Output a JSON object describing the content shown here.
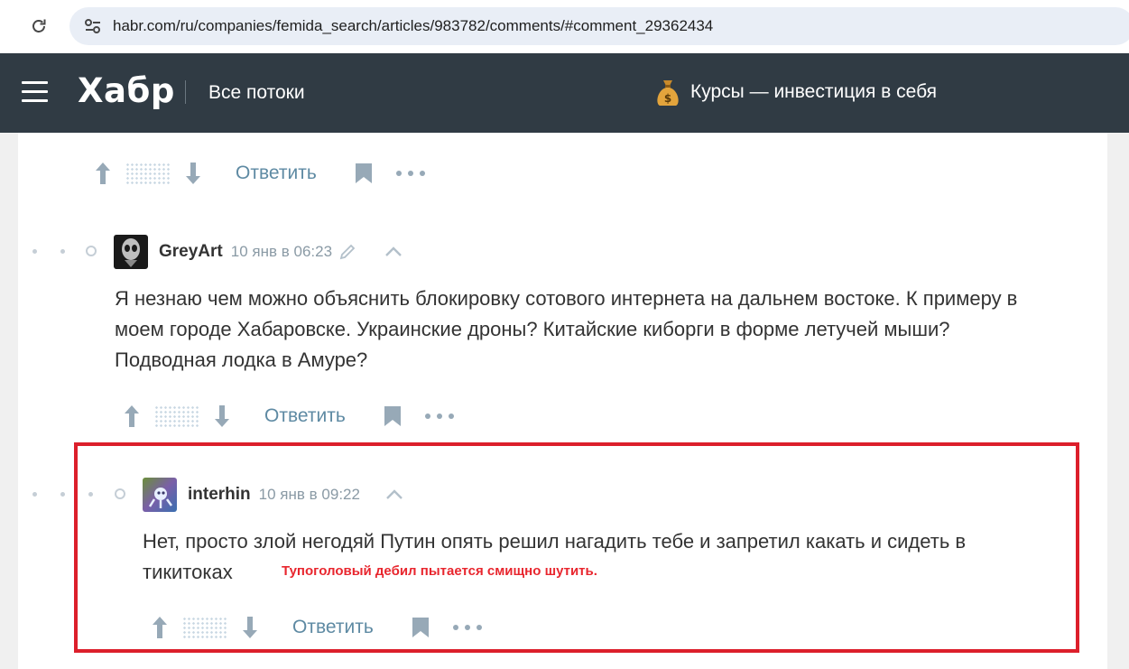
{
  "browser": {
    "url": "habr.com/ru/companies/femida_search/articles/983782/comments/#comment_29362434"
  },
  "header": {
    "logo": "Хабр",
    "nav_label": "Все потоки",
    "promo_icon": "money-bag-icon",
    "promo_label": "Курсы — инвестиция в себя"
  },
  "actions": {
    "reply_label": "Ответить"
  },
  "comments": [
    {
      "author": "GreyArt",
      "time": "10 янв в 06:23",
      "edited": true,
      "lines": [
        "Я незнаю чем можно объяснить блокировку сотового интернета на дальнем востоке. К примеру в",
        "моем городе Хабаровске. Украинские дроны? Китайские киборги в форме летучей мыши?",
        "Подводная лодка в Амуре?"
      ]
    },
    {
      "author": "interhin",
      "time": "10 янв в 09:22",
      "edited": false,
      "lines": [
        "Нет, просто злой негодяй Путин опять решил нагадить тебе и запретил какать и сидеть в",
        "тикитоках"
      ]
    }
  ],
  "annotation": {
    "text": "Тупоголовый дебил пытается смищно шутить.",
    "color": "#dc1f2b"
  },
  "colors": {
    "header_bg": "#303b44",
    "reply_link": "#5e8aa3",
    "icon_grey": "#97a9b7"
  }
}
